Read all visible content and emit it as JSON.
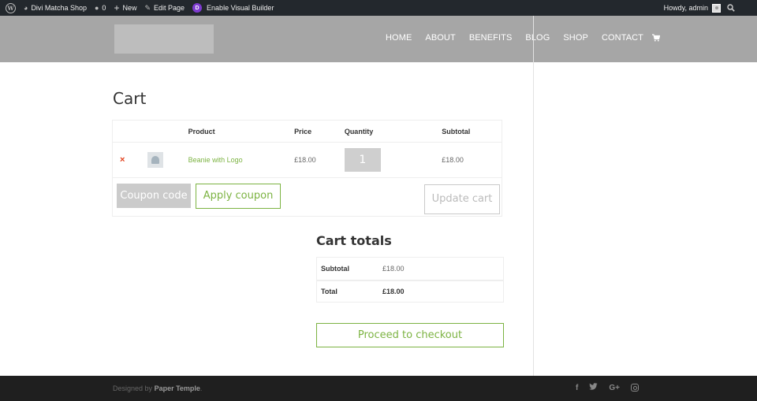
{
  "admin_bar": {
    "site_name": "Divi Matcha Shop",
    "comments_count": "0",
    "new_label": "New",
    "edit_page_label": "Edit Page",
    "visual_builder_label": "Enable Visual Builder",
    "howdy_label": "Howdy, admin"
  },
  "nav": {
    "items": [
      "HOME",
      "ABOUT",
      "BENEFITS",
      "BLOG",
      "SHOP",
      "CONTACT"
    ]
  },
  "page": {
    "title": "Cart"
  },
  "cart_table": {
    "headers": {
      "product": "Product",
      "price": "Price",
      "quantity": "Quantity",
      "subtotal": "Subtotal"
    },
    "items": [
      {
        "remove_glyph": "×",
        "product": "Beanie with Logo",
        "price": "£18.00",
        "quantity": "1",
        "subtotal": "£18.00"
      }
    ],
    "coupon_placeholder": "Coupon code",
    "apply_coupon_label": "Apply coupon",
    "update_cart_label": "Update cart"
  },
  "cart_totals": {
    "title": "Cart totals",
    "subtotal_label": "Subtotal",
    "subtotal_value": "£18.00",
    "total_label": "Total",
    "total_value": "£18.00",
    "checkout_label": "Proceed to checkout"
  },
  "footer": {
    "designed_by": "Designed by",
    "brand": "Paper Temple",
    "suffix": ".",
    "social_icons": [
      "facebook-icon",
      "twitter-icon",
      "google-plus-icon",
      "instagram-icon"
    ]
  },
  "colors": {
    "accent": "#7cb342",
    "admin_bar": "#23282d",
    "header": "#a6a6a6",
    "footer": "#1f1f1f",
    "remove": "#e2401c"
  }
}
